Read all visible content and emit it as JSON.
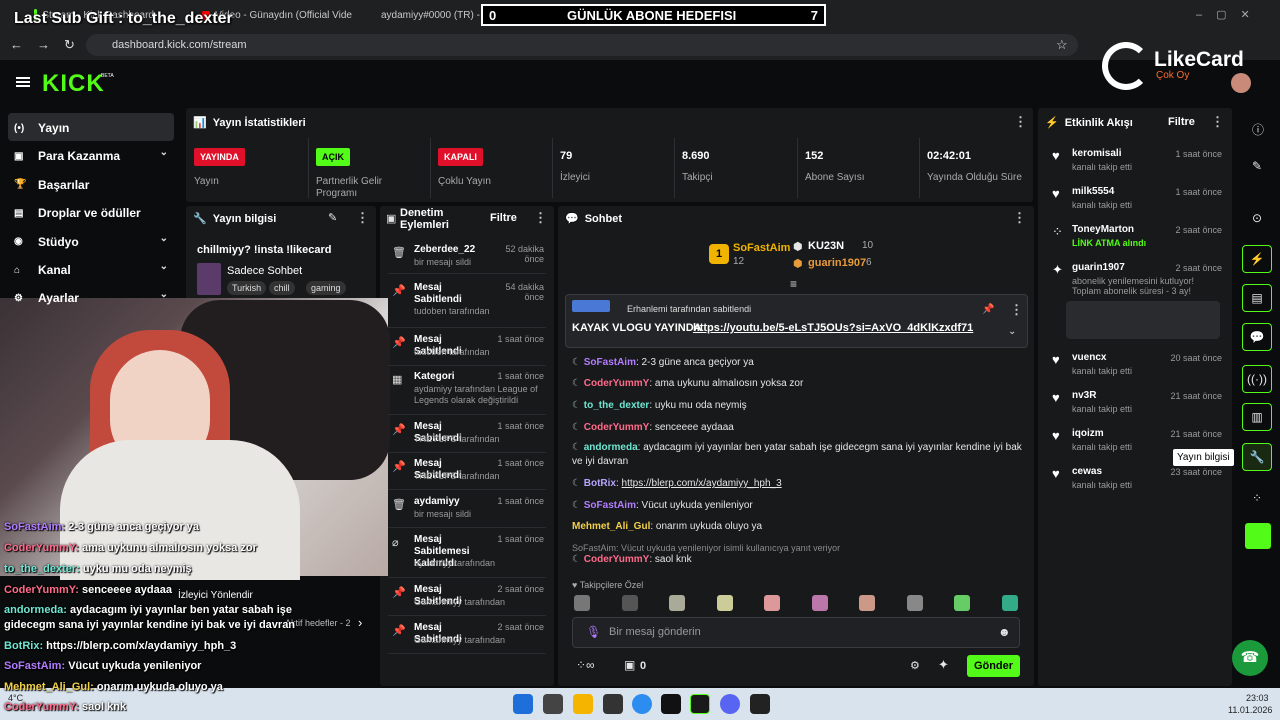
{
  "browser": {
    "tabs": [
      "Stream - Kick Dashboard",
      "Video - Günaydın (Official Vide",
      "aydamiyy#0000 (TR) - League"
    ],
    "url": "dashboard.kick.com/stream"
  },
  "overlay": {
    "last_sub": "Last Sub Gift : to_the_dexter",
    "goal_left": "0",
    "goal_title": "GÜNLÜK ABONE HEDEFISI",
    "goal_right": "7",
    "likecard": "LikeCard",
    "likecard_sub": "Çok Oy"
  },
  "logo": "KICK",
  "logo_beta": "BETA",
  "nav": [
    {
      "label": "Yayın",
      "icon": "broadcast-icon"
    },
    {
      "label": "Para Kazanma",
      "icon": "money-icon"
    },
    {
      "label": "Başarılar",
      "icon": "trophy-icon"
    },
    {
      "label": "Droplar ve ödüller",
      "icon": "gift-icon"
    },
    {
      "label": "Stüdyo",
      "icon": "studio-icon"
    },
    {
      "label": "Kanal",
      "icon": "channel-icon"
    },
    {
      "label": "Ayarlar",
      "icon": "settings-icon"
    }
  ],
  "stats": {
    "title": "Yayın İstatistikleri",
    "items": [
      {
        "badge": "YAYINDA",
        "label": "Yayın",
        "badge_color": "#e0102a"
      },
      {
        "badge": "AÇIK",
        "label": "Partnerlik Gelir Programı",
        "badge_color": "#53fc18"
      },
      {
        "badge": "KAPALI",
        "label": "Çoklu Yayın",
        "badge_color": "#e0102a"
      },
      {
        "value": "79",
        "label": "İzleyici"
      },
      {
        "value": "8.690",
        "label": "Takipçi"
      },
      {
        "value": "152",
        "label": "Abone Sayısı"
      },
      {
        "value": "02:42:01",
        "label": "Yayında Olduğu Süre"
      }
    ]
  },
  "stream_info": {
    "title": "Yayın bilgisi",
    "stream_title": "chillmiyy? !insta !likecard",
    "category": "Sadece Sohbet",
    "tags": [
      "Turkish",
      "chill",
      "gaming"
    ]
  },
  "mod_actions": {
    "title": "Denetim Eylemleri",
    "filter": "Filtre",
    "items": [
      {
        "t": "Zeberdee_22",
        "tm": "52 dakika önce",
        "s": "bir mesajı sildi",
        "icon": "trash-icon"
      },
      {
        "t": "Mesaj Sabitlendi",
        "tm": "54 dakika önce",
        "s": "tudoben tarafından",
        "icon": "pin-icon"
      },
      {
        "t": "Mesaj Sabitlendi",
        "tm": "1 saat önce",
        "s": "tudoben tarafından",
        "icon": "pin-icon"
      },
      {
        "t": "Kategori",
        "tm": "1 saat önce",
        "s": "aydamiyy tarafından League of Legends olarak değiştirildi",
        "icon": "category-icon"
      },
      {
        "t": "Mesaj Sabitlendi",
        "tm": "1 saat önce",
        "s": "THEYUPS tarafından",
        "icon": "pin-icon"
      },
      {
        "t": "Mesaj Sabitlendi",
        "tm": "1 saat önce",
        "s": "THEYUPS tarafından",
        "icon": "pin-icon"
      },
      {
        "t": "aydamiyy",
        "tm": "1 saat önce",
        "s": "bir mesajı sildi",
        "icon": "trash-icon"
      },
      {
        "t": "Mesaj Sabitlemesi Kaldırıldı",
        "tm": "1 saat önce",
        "s": "aydamiyy tarafından",
        "icon": "unpin-icon"
      },
      {
        "t": "Mesaj Sabitlendi",
        "tm": "2 saat önce",
        "s": "Gurkanmiyy tarafından",
        "icon": "pin-icon"
      },
      {
        "t": "Mesaj Sabitlendi",
        "tm": "2 saat önce",
        "s": "Gurkanmiyy tarafından",
        "icon": "pin-icon"
      }
    ]
  },
  "chat": {
    "title": "Sohbet",
    "leaders": [
      {
        "rank": "1",
        "name": "SoFastAim",
        "count": "12"
      },
      {
        "name": "KU23N",
        "count": "10"
      },
      {
        "name": "guarin1907",
        "count": "6"
      }
    ],
    "pinned_by": "Erhanlemi tarafından sabitlendi",
    "pinned_text": "KAYAK VLOGU YAYINDA",
    "pinned_link": "https://youtu.be/5-eLsTJ5OUs?si=AxVO_4dKlKzxdf71",
    "messages": [
      {
        "u": "SoFastAim",
        "c": "u1",
        "m": "2-3 güne anca geçiyor ya"
      },
      {
        "u": "CoderYummY",
        "c": "u2",
        "m": "ama uykunu almalıosın yoksa zor"
      },
      {
        "u": "to_the_dexter",
        "c": "u3",
        "m": "uyku mu oda neymiş"
      },
      {
        "u": "CoderYummY",
        "c": "u2",
        "m": "senceeee aydaaa"
      },
      {
        "u": "andormeda",
        "c": "u3",
        "m": "aydacagım iyi yayınlar ben yatar sabah işe gidecegm sana iyi yayınlar kendine iyi bak ve iyi davran"
      },
      {
        "u": "BotRix",
        "c": "u4",
        "m": "https://blerp.com/x/aydamiyy_hph_3"
      },
      {
        "u": "SoFastAim",
        "c": "u1",
        "m": "Vücut uykuda yenileniyor"
      },
      {
        "u": "Mehmet_Ali_Gul",
        "c": "u5",
        "m": "onarım uykuda oluyo ya"
      }
    ],
    "reply_hint": "SoFastAim: Vücut uykuda yenileniyor isimli kullanıcıya yanıt veriyor",
    "reply_msg_user": "CoderYummY",
    "reply_msg": "saol knk",
    "followers_only": "Takipçilere Özel",
    "input_placeholder": "Bir mesaj gönderin",
    "points": "0",
    "send": "Gönder"
  },
  "activity": {
    "title": "Etkinlik Akışı",
    "filter": "Filtre",
    "items": [
      {
        "n": "keromisali",
        "tm": "1 saat önce",
        "s": "kanalı takip etti"
      },
      {
        "n": "milk5554",
        "tm": "1 saat önce",
        "s": "kanalı takip etti"
      },
      {
        "n": "ToneyMarton",
        "tm": "2 saat önce",
        "s": "LİNK ATMA alındı"
      },
      {
        "n": "guarin1907",
        "tm": "2 saat önce",
        "s": "abonelik yenilemesini kutluyor! Toplam abonelik süresi - 3 ay!"
      },
      {
        "n": "vuencx",
        "tm": "20 saat önce",
        "s": "kanalı takip etti"
      },
      {
        "n": "nv3R",
        "tm": "21 saat önce",
        "s": "kanalı takip etti"
      },
      {
        "n": "iqoizm",
        "tm": "21 saat önce",
        "s": "kanalı takip etti"
      },
      {
        "n": "cewas",
        "tm": "23 saat önce",
        "s": "kanalı takip etti"
      }
    ]
  },
  "tooltip": "Yayın bilgisi",
  "webcam_overlay": {
    "viewer_direct": "İzleyici Yönlendir",
    "goal_text": "Aktif hedefler - 2",
    "chat": [
      {
        "u": "SoFastAim:",
        "m": "2-3 güne anca geçiyor ya"
      },
      {
        "u": "CoderYummY:",
        "m": "ama uykunu almalıosın yoksa zor"
      },
      {
        "u": "to_the_dexter:",
        "m": "uyku mu oda neymiş"
      },
      {
        "u": "CoderYummY:",
        "m": "senceeee aydaaa"
      },
      {
        "u": "andormeda:",
        "m": "aydacagım iyi yayınlar ben yatar sabah işe"
      },
      {
        "u": "",
        "m": "gidecegm sana iyi yayınlar kendine iyi bak ve iyi davran"
      },
      {
        "u": "BotRix:",
        "m": "https://blerp.com/x/aydamiyy_hph_3"
      },
      {
        "u": "SoFastAim:",
        "m": "Vücut uykuda yenileniyor"
      },
      {
        "u": "Mehmet_Ali_Gul:",
        "m": "onarım uykuda oluyo ya"
      },
      {
        "u": "CoderYummY:",
        "m": "saol knk"
      }
    ]
  },
  "taskbar": {
    "temp": "4°C",
    "time": "23:03",
    "date": "11.01.2026"
  }
}
